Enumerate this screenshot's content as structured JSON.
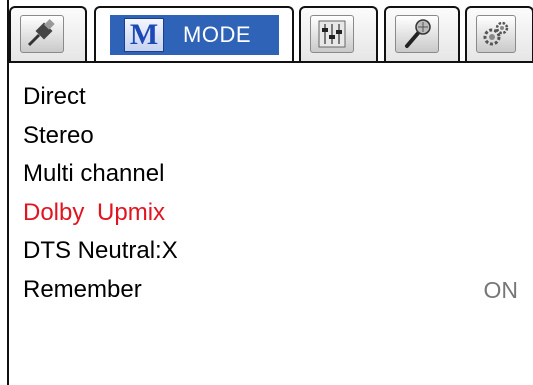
{
  "tabs": [
    {
      "id": "input",
      "icon": "hdmi-cable-icon"
    },
    {
      "id": "mode",
      "label": "MODE",
      "logo_letter": "M",
      "active": true
    },
    {
      "id": "audio",
      "icon": "mixer-sliders-icon"
    },
    {
      "id": "karaoke",
      "icon": "microphone-icon"
    },
    {
      "id": "settings",
      "icon": "gears-icon"
    }
  ],
  "menu": {
    "items": [
      {
        "label": "Direct"
      },
      {
        "label": "Stereo"
      },
      {
        "label": "Multi channel"
      },
      {
        "label": "Dolby  Upmix",
        "selected": true
      },
      {
        "label": "DTS Neutral:X"
      },
      {
        "label": "Remember",
        "value": "ON"
      }
    ]
  },
  "colors": {
    "accent": "#2f63b8",
    "selected_text": "#e11522",
    "value_text": "#777777"
  }
}
